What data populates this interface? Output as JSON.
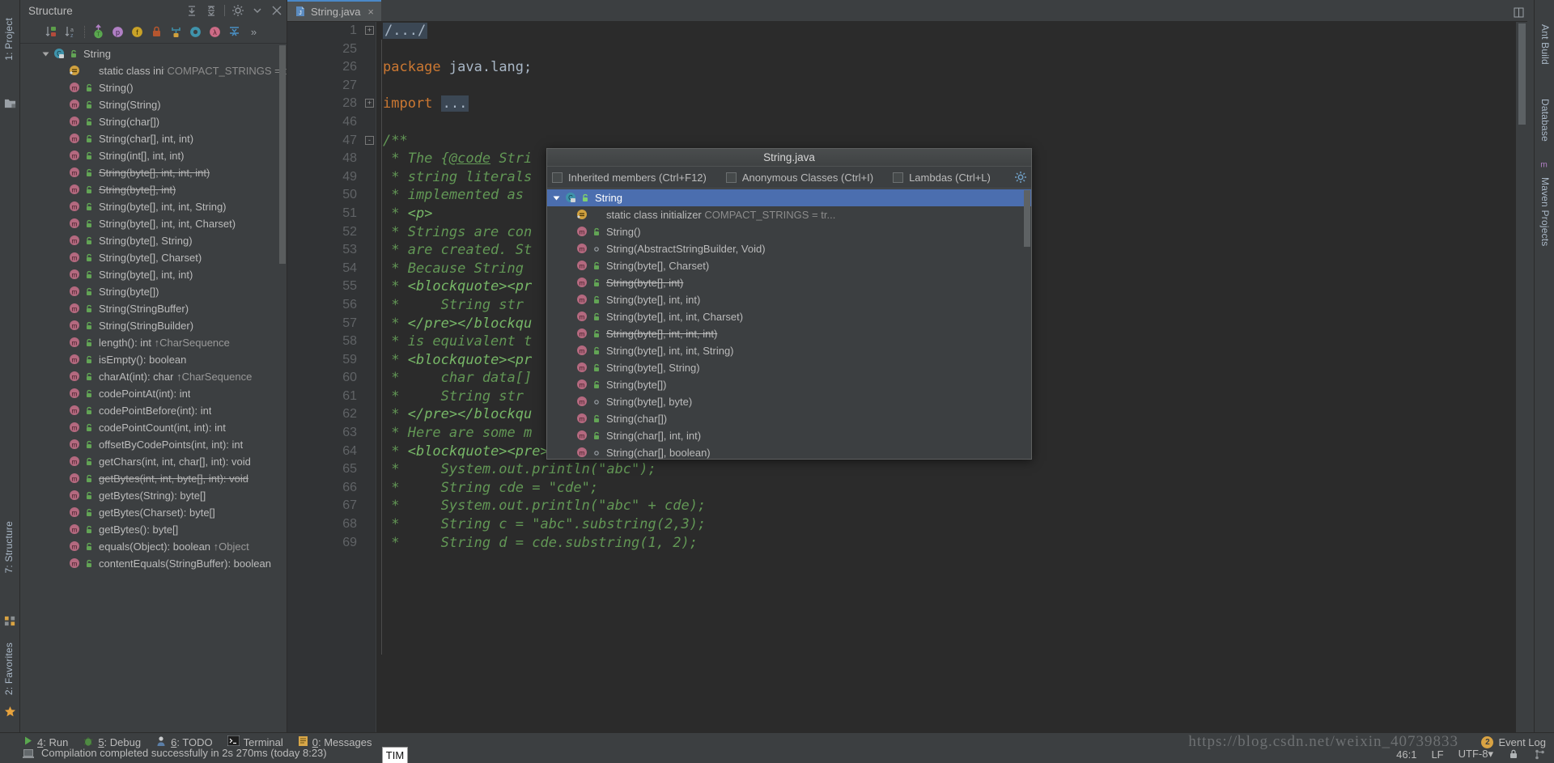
{
  "window": {
    "title": "String.java"
  },
  "left_rail": {
    "project_label": "1: Project",
    "structure_label": "7: Structure",
    "favorites_label": "2: Favorites"
  },
  "right_rail": {
    "ant_build_label": "Ant Build",
    "database_label": "Database",
    "maven_label": "Maven Projects"
  },
  "structure_panel": {
    "title": "Structure",
    "header_icons": [
      "expand-all-icon",
      "collapse-all-icon",
      "settings-icon",
      "hide-icon"
    ],
    "toolbar_icons": [
      "sort-by-visibility-icon",
      "sort-alphabetically-icon",
      "show-inherited-icon",
      "show-properties-icon",
      "show-fields-icon",
      "show-non-public-icon",
      "group-methods-icon",
      "show-anonymous-icon",
      "show-lambdas-icon",
      "autoscroll-icon",
      "more-icon"
    ],
    "root": {
      "label": "String",
      "icon": "class-icon",
      "visibility": "public-icon"
    },
    "items": [
      {
        "label": "static class initializer",
        "detail": "COMPACT_STRINGS = t",
        "icon": "initializer-icon",
        "vis": "",
        "struck": false
      },
      {
        "label": "String()",
        "icon": "method-icon",
        "vis": "public-icon",
        "struck": false
      },
      {
        "label": "String(String)",
        "icon": "method-icon",
        "vis": "public-icon",
        "struck": false
      },
      {
        "label": "String(char[])",
        "icon": "method-icon",
        "vis": "public-icon",
        "struck": false
      },
      {
        "label": "String(char[], int, int)",
        "icon": "method-icon",
        "vis": "public-icon",
        "struck": false
      },
      {
        "label": "String(int[], int, int)",
        "icon": "method-icon",
        "vis": "public-icon",
        "struck": false
      },
      {
        "label": "String(byte[], int, int, int)",
        "icon": "method-icon",
        "vis": "public-icon",
        "struck": true
      },
      {
        "label": "String(byte[], int)",
        "icon": "method-icon",
        "vis": "public-icon",
        "struck": true
      },
      {
        "label": "String(byte[], int, int, String)",
        "icon": "method-icon",
        "vis": "public-icon",
        "struck": false
      },
      {
        "label": "String(byte[], int, int, Charset)",
        "icon": "method-icon",
        "vis": "public-icon",
        "struck": false
      },
      {
        "label": "String(byte[], String)",
        "icon": "method-icon",
        "vis": "public-icon",
        "struck": false
      },
      {
        "label": "String(byte[], Charset)",
        "icon": "method-icon",
        "vis": "public-icon",
        "struck": false
      },
      {
        "label": "String(byte[], int, int)",
        "icon": "method-icon",
        "vis": "public-icon",
        "struck": false
      },
      {
        "label": "String(byte[])",
        "icon": "method-icon",
        "vis": "public-icon",
        "struck": false
      },
      {
        "label": "String(StringBuffer)",
        "icon": "method-icon",
        "vis": "public-icon",
        "struck": false
      },
      {
        "label": "String(StringBuilder)",
        "icon": "method-icon",
        "vis": "public-icon",
        "struck": false
      },
      {
        "label": "length(): int",
        "override": "↑CharSequence",
        "icon": "method-icon",
        "vis": "public-icon",
        "struck": false
      },
      {
        "label": "isEmpty(): boolean",
        "icon": "method-icon",
        "vis": "public-icon",
        "struck": false
      },
      {
        "label": "charAt(int): char",
        "override": "↑CharSequence",
        "icon": "method-icon",
        "vis": "public-icon",
        "struck": false
      },
      {
        "label": "codePointAt(int): int",
        "icon": "method-icon",
        "vis": "public-icon",
        "struck": false
      },
      {
        "label": "codePointBefore(int): int",
        "icon": "method-icon",
        "vis": "public-icon",
        "struck": false
      },
      {
        "label": "codePointCount(int, int): int",
        "icon": "method-icon",
        "vis": "public-icon",
        "struck": false
      },
      {
        "label": "offsetByCodePoints(int, int): int",
        "icon": "method-icon",
        "vis": "public-icon",
        "struck": false
      },
      {
        "label": "getChars(int, int, char[], int): void",
        "icon": "method-icon",
        "vis": "public-icon",
        "struck": false
      },
      {
        "label": "getBytes(int, int, byte[], int): void",
        "icon": "method-icon",
        "vis": "public-icon",
        "struck": true
      },
      {
        "label": "getBytes(String): byte[]",
        "icon": "method-icon",
        "vis": "public-icon",
        "struck": false
      },
      {
        "label": "getBytes(Charset): byte[]",
        "icon": "method-icon",
        "vis": "public-icon",
        "struck": false
      },
      {
        "label": "getBytes(): byte[]",
        "icon": "method-icon",
        "vis": "public-icon",
        "struck": false
      },
      {
        "label": "equals(Object): boolean",
        "override": "↑Object",
        "icon": "method-icon",
        "vis": "public-icon",
        "struck": false
      },
      {
        "label": "contentEquals(StringBuffer): boolean",
        "icon": "method-icon",
        "vis": "public-icon",
        "struck": false
      }
    ]
  },
  "editor": {
    "tab": {
      "label": "String.java",
      "icon": "java-file-icon",
      "close": "×"
    },
    "lines": [
      {
        "num": "1",
        "fold": "+",
        "text": "/.../",
        "style": "folded-comment"
      },
      {
        "num": "25",
        "text": ""
      },
      {
        "num": "26",
        "text": "package java.lang;",
        "style": "package"
      },
      {
        "num": "27",
        "text": ""
      },
      {
        "num": "28",
        "fold": "+",
        "text": "import ...",
        "style": "import"
      },
      {
        "num": "46",
        "text": ""
      },
      {
        "num": "47",
        "fold": "-",
        "text": "/**",
        "style": "comment"
      },
      {
        "num": "48",
        "text": " * The {@code Stri",
        "style": "comment-code"
      },
      {
        "num": "49",
        "text": " * string literals",
        "style": "comment"
      },
      {
        "num": "50",
        "text": " * implemented as ",
        "style": "comment"
      },
      {
        "num": "51",
        "text": " * <p>",
        "style": "comment-tag"
      },
      {
        "num": "52",
        "text": " * Strings are con",
        "style": "comment"
      },
      {
        "num": "53",
        "text": " * are created. St",
        "style": "comment"
      },
      {
        "num": "54",
        "text": " * Because String ",
        "style": "comment"
      },
      {
        "num": "55",
        "text": " * <blockquote><pr",
        "style": "comment-tag"
      },
      {
        "num": "56",
        "text": " *     String str ",
        "style": "comment"
      },
      {
        "num": "57",
        "text": " * </pre></blockqu",
        "style": "comment-tag"
      },
      {
        "num": "58",
        "text": " * is equivalent t",
        "style": "comment"
      },
      {
        "num": "59",
        "text": " * <blockquote><pr",
        "style": "comment-tag"
      },
      {
        "num": "60",
        "text": " *     char data[]",
        "style": "comment"
      },
      {
        "num": "61",
        "text": " *     String str ",
        "style": "comment"
      },
      {
        "num": "62",
        "text": " * </pre></blockqu",
        "style": "comment-tag"
      },
      {
        "num": "63",
        "text": " * Here are some m",
        "style": "comment"
      },
      {
        "num": "64",
        "text": " * <blockquote><pre>",
        "style": "comment-tag"
      },
      {
        "num": "65",
        "text": " *     System.out.println(\"abc\");",
        "style": "comment"
      },
      {
        "num": "66",
        "text": " *     String cde = \"cde\";",
        "style": "comment"
      },
      {
        "num": "67",
        "text": " *     System.out.println(\"abc\" + cde);",
        "style": "comment"
      },
      {
        "num": "68",
        "text": " *     String c = \"abc\".substring(2,3);",
        "style": "comment"
      },
      {
        "num": "69",
        "text": " *     String d = cde.substring(1, 2);",
        "style": "comment"
      }
    ]
  },
  "popup": {
    "title": "String.java",
    "filters": [
      {
        "label": "Inherited members (Ctrl+F12)",
        "checked": false
      },
      {
        "label": "Anonymous Classes (Ctrl+I)",
        "checked": false
      },
      {
        "label": "Lambdas (Ctrl+L)",
        "checked": false
      }
    ],
    "gear_icon": "settings-gear-icon",
    "root": {
      "label": "String",
      "selected": true,
      "icon": "class-icon",
      "vis": "public-icon"
    },
    "items": [
      {
        "label": "static class initializer",
        "detail": "COMPACT_STRINGS = tr...",
        "icon": "initializer-icon",
        "vis": "",
        "struck": false
      },
      {
        "label": "String()",
        "icon": "method-icon",
        "vis": "public-icon",
        "struck": false
      },
      {
        "label": "String(AbstractStringBuilder, Void)",
        "icon": "method-icon",
        "vis": "package-private-icon",
        "struck": false
      },
      {
        "label": "String(byte[], Charset)",
        "icon": "method-icon",
        "vis": "public-icon",
        "struck": false
      },
      {
        "label": "String(byte[], int)",
        "icon": "method-icon",
        "vis": "public-icon",
        "struck": true
      },
      {
        "label": "String(byte[], int, int)",
        "icon": "method-icon",
        "vis": "public-icon",
        "struck": false
      },
      {
        "label": "String(byte[], int, int, Charset)",
        "icon": "method-icon",
        "vis": "public-icon",
        "struck": false
      },
      {
        "label": "String(byte[], int, int, int)",
        "icon": "method-icon",
        "vis": "public-icon",
        "struck": true
      },
      {
        "label": "String(byte[], int, int, String)",
        "icon": "method-icon",
        "vis": "public-icon",
        "struck": false
      },
      {
        "label": "String(byte[], String)",
        "icon": "method-icon",
        "vis": "public-icon",
        "struck": false
      },
      {
        "label": "String(byte[])",
        "icon": "method-icon",
        "vis": "public-icon",
        "struck": false
      },
      {
        "label": "String(byte[], byte)",
        "icon": "method-icon",
        "vis": "package-private-icon",
        "struck": false
      },
      {
        "label": "String(char[])",
        "icon": "method-icon",
        "vis": "public-icon",
        "struck": false
      },
      {
        "label": "String(char[], int, int)",
        "icon": "method-icon",
        "vis": "public-icon",
        "struck": false
      },
      {
        "label": "String(char[], boolean)",
        "icon": "method-icon",
        "vis": "package-private-icon",
        "struck": false
      }
    ]
  },
  "bottom_bar": {
    "items": [
      {
        "key": "4",
        "label": ": Run",
        "icon": "run-icon"
      },
      {
        "key": "5",
        "label": ": Debug",
        "icon": "debug-icon"
      },
      {
        "key": "6",
        "label": ": TODO",
        "icon": "todo-icon"
      },
      {
        "key": "",
        "label": "Terminal",
        "icon": "terminal-icon"
      },
      {
        "key": "0",
        "label": ": Messages",
        "icon": "messages-icon"
      }
    ],
    "event_log": {
      "label": "Event Log",
      "count": "2"
    }
  },
  "status": {
    "message": "Compilation completed successfully in 2s 270ms (today 8:23)",
    "caret": "46:1",
    "line_separator": "LF",
    "encoding": "UTF-8",
    "lock_icon": "lock-icon",
    "vcs_icon": "git-branch-icon"
  },
  "watermark": "https://blog.csdn.net/weixin_40739833",
  "tooltip": {
    "text": "TIM"
  }
}
